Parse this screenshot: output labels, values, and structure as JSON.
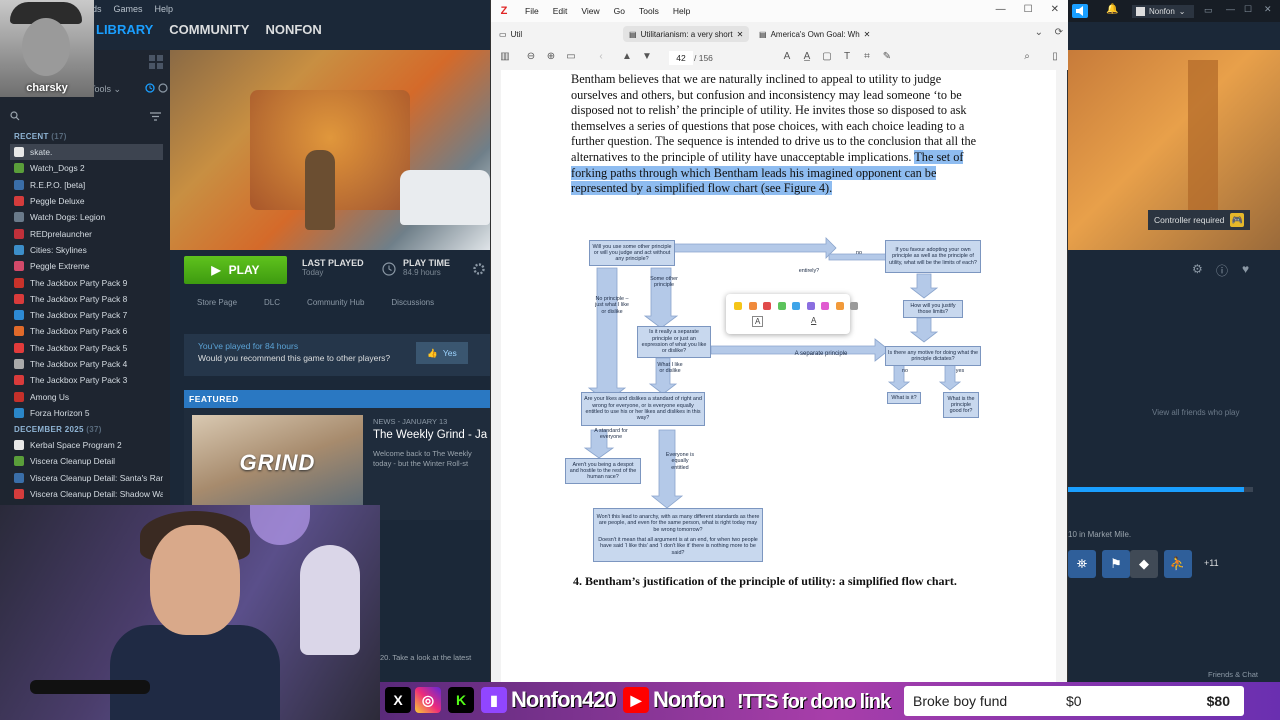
{
  "steam": {
    "menu": [
      "ds",
      "Games",
      "Help"
    ],
    "nav": [
      "LIBRARY",
      "COMMUNITY",
      "NONFON"
    ],
    "tools_label": "Tools",
    "recent_label": "RECENT",
    "recent_count": "(17)",
    "recent_games": [
      "skate.",
      "Watch_Dogs 2",
      "R.E.P.O. [beta]",
      "Peggle Deluxe",
      "Watch Dogs: Legion",
      "REDprelauncher",
      "Cities: Skylines",
      "Peggle Extreme",
      "The Jackbox Party Pack 9",
      "The Jackbox Party Pack 8",
      "The Jackbox Party Pack 7",
      "The Jackbox Party Pack 6",
      "The Jackbox Party Pack 5",
      "The Jackbox Party Pack 4",
      "The Jackbox Party Pack 3",
      "Among Us",
      "Forza Horizon 5"
    ],
    "december_label": "DECEMBER 2025",
    "december_count": "(37)",
    "december_games": [
      "Kerbal Space Program 2",
      "Viscera Cleanup Detail",
      "Viscera Cleanup Detail: Santa's Ran",
      "Viscera Cleanup Detail: Shadow Wa"
    ],
    "play_label": "PLAY",
    "last_played_label": "LAST PLAYED",
    "last_played_value": "Today",
    "play_time_label": "PLAY TIME",
    "play_time_value": "84.9 hours",
    "tabs": [
      "Store Page",
      "DLC",
      "Community Hub",
      "Discussions"
    ],
    "review_line1": "You've played for 84 hours",
    "review_line2": "Would you recommend this game to other players?",
    "yes_label": "Yes",
    "featured_label": "FEATURED",
    "featured_img_text": "GRIND",
    "news_date": "NEWS - JANUARY 13",
    "news_title": "The Weekly Grind - Ja",
    "news_body_1": "Welcome back to The Weekly",
    "news_body_2": "today - but the Winter Roll-st",
    "lower_text": "20. Take a look at the latest"
  },
  "streamer": {
    "name": "charsky"
  },
  "pdf": {
    "logo": "Z",
    "menu": [
      "File",
      "Edit",
      "View",
      "Go",
      "Tools",
      "Help"
    ],
    "tabs": [
      "Util",
      "Utilitarianism: a very short",
      "America's Own Goal: Wh"
    ],
    "page_current": "42",
    "page_total": "/ 156",
    "para_plain": "Bentham believes that we are naturally inclined to appeal to utility to judge ourselves and others, but confusion and inconsistency may lead someone ‘to be disposed not to relish’ the principle of utility. He invites those so disposed to ask themselves a series of questions that pose choices, with each choice leading to a further question. The sequence is intended to drive us to the conclusion that all the alternatives to the principle of utility have unacceptable implications. ",
    "para_highlight": "The set of forking paths through which Bentham leads his imagined opponent can be represented by a simplified flow chart (see Figure 4).",
    "caption": "4. Bentham’s justification of the principle of utility: a simplified flow chart.",
    "palette_colors": [
      "#f5c518",
      "#f08a3c",
      "#e04b4b",
      "#5cc35c",
      "#3fa4e8",
      "#8a6ee0",
      "#e05bd0",
      "#f29a3a",
      "#9a9a9a"
    ],
    "flow": {
      "q1": "Will you use some other principle or will you judge and act without any principle?",
      "q_right_top": "If you favour adopting your own principle as well as the principle of utility, what will be the limits of each?",
      "q_entirely": "entirely?",
      "lbl_no_top": "no",
      "lbl_no_principle": "No principle – just what I like or dislike",
      "lbl_some_other": "Some other principle",
      "q_separate": "Is it really a separate principle or just an expression of what you like or dislike?",
      "q_justify": "How will you justify those limits?",
      "lbl_separate": "A separate principle",
      "q_motive": "Is there any motive for doing what the principle dictates?",
      "lbl_no": "no",
      "lbl_yes": "yes",
      "q_what": "What is it?",
      "q_good": "What is the principle good for?",
      "lbl_what_like": "What I like or dislike",
      "q_standard": "Are your likes and dislikes a standard of right and wrong for everyone, or is everyone equally entitled to use his or her likes and dislikes in this way?",
      "lbl_standard": "A standard for everyone",
      "lbl_equal": "Everyone is equally entitled",
      "q_despot": "Aren't you being a despot and hostile to the rest of the human race?",
      "q_anarchy": "Won't this lead to anarchy, with as many different standards as there are people, and even for the same person, what is right today may be wrong tomorrow?",
      "q_end": "Doesn't it mean that all argument is at an end, for when two people have said ‘I like this’ and ‘I don't like it’ there is nothing more to be said?"
    }
  },
  "steam_right": {
    "user": "Nonfon",
    "controller_required": "Controller required",
    "view_friends": "View all friends who play",
    "progress": 0.95,
    "ach_text": "10 in Market Mile.",
    "ach_more": "+11",
    "friends_chat": "Friends & Chat"
  },
  "stream_bar": {
    "twitch_name": "Nonfon420",
    "youtube_name": "Nonfon",
    "tts": "!TTS for dono link",
    "fund_label": "Broke boy fund",
    "fund_current": "$0",
    "fund_goal": "$80",
    "brand_colors": {
      "x": "#000000",
      "instagram": "#d6249f",
      "kick": "#53fc18",
      "twitch": "#9146ff",
      "youtube": "#ff0000"
    }
  }
}
